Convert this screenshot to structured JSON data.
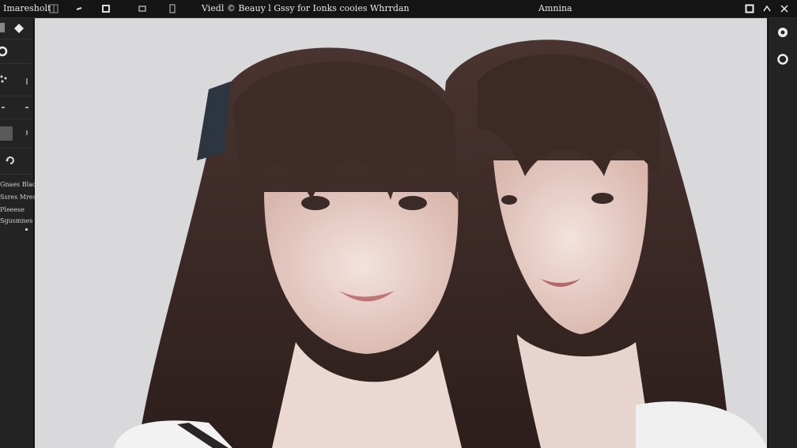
{
  "app": {
    "menu_label": "Imaresholt",
    "window_title": "Viedl © Beauy l Gssy for Ionks cooies Whrrdan",
    "mode_label": "Amnina"
  },
  "left_panel": {
    "labels": [
      "Gnaes Blaos",
      "Ssres Mreso",
      "Pleeese",
      "Sgusmnes"
    ]
  },
  "canvas": {
    "subject": "two-portraits",
    "background_color": "#d9d9db",
    "hair_color": "#3a2826"
  },
  "icons": {
    "topbar": [
      "grid-icon",
      "arrow-icon",
      "crop-icon",
      "layer-icon",
      "page-icon"
    ],
    "window": [
      "square-icon",
      "caret-up-icon",
      "close-icon"
    ],
    "right": [
      "circle-icon",
      "ring-icon"
    ]
  }
}
